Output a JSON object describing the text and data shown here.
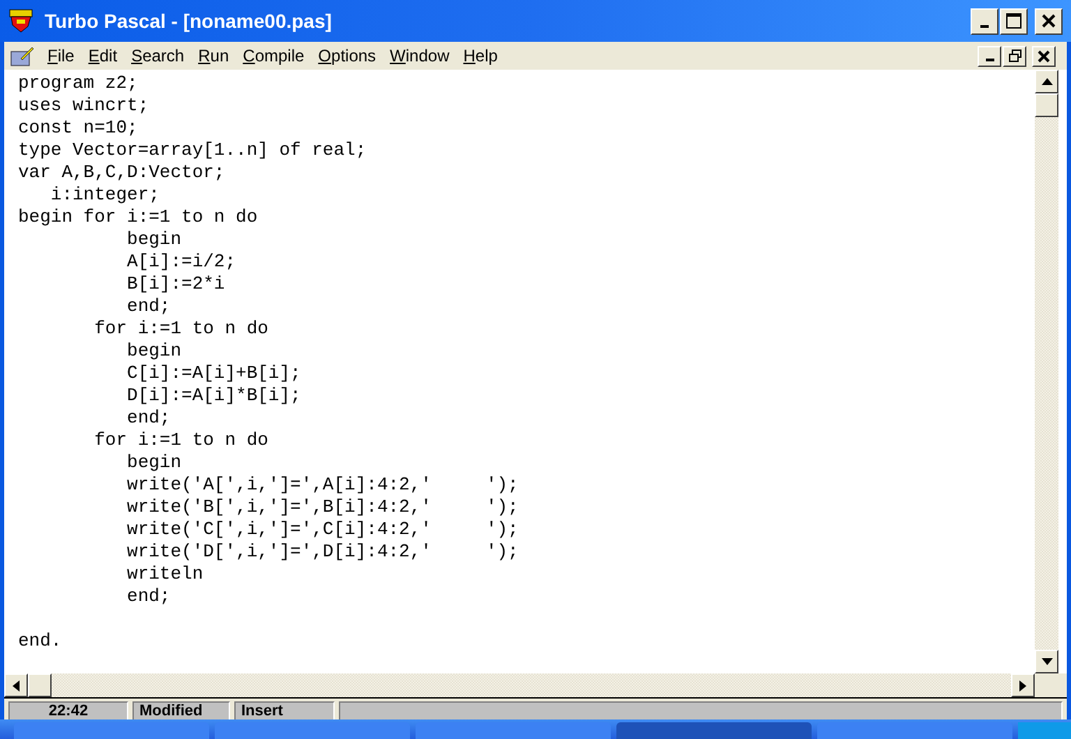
{
  "window": {
    "title": "Turbo Pascal - [noname00.pas]"
  },
  "menu": [
    {
      "label": "File"
    },
    {
      "label": "Edit"
    },
    {
      "label": "Search"
    },
    {
      "label": "Run"
    },
    {
      "label": "Compile"
    },
    {
      "label": "Options"
    },
    {
      "label": "Window"
    },
    {
      "label": "Help"
    }
  ],
  "editor": {
    "blocks": [
      [
        "program z2;",
        "uses wincrt;",
        "const n=10;",
        "type Vector=array[1..n] of real;",
        "var A,B,C,D:Vector;",
        "   i:integer;",
        "begin for i:=1 to n do",
        "          begin",
        "          A[i]:=i/2;",
        "          B[i]:=2*i",
        "          end;",
        "       for i:=1 to n do",
        "          begin",
        "          C[i]:=A[i]+B[i];",
        "          D[i]:=A[i]*B[i];",
        "          end;",
        "       for i:=1 to n do",
        "          begin",
        "          write('A[',i,']=',A[i]:4:2,'     ');",
        "          write('B[',i,']=',B[i]:4:2,'     ');",
        "          write('C[',i,']=',C[i]:4:2,'     ');",
        "          write('D[',i,']=',D[i]:4:2,'     ');",
        "          writeln",
        "          end;"
      ],
      [
        "end."
      ]
    ]
  },
  "status_bar": {
    "position": "22:42",
    "modified": "Modified",
    "mode": "Insert"
  }
}
